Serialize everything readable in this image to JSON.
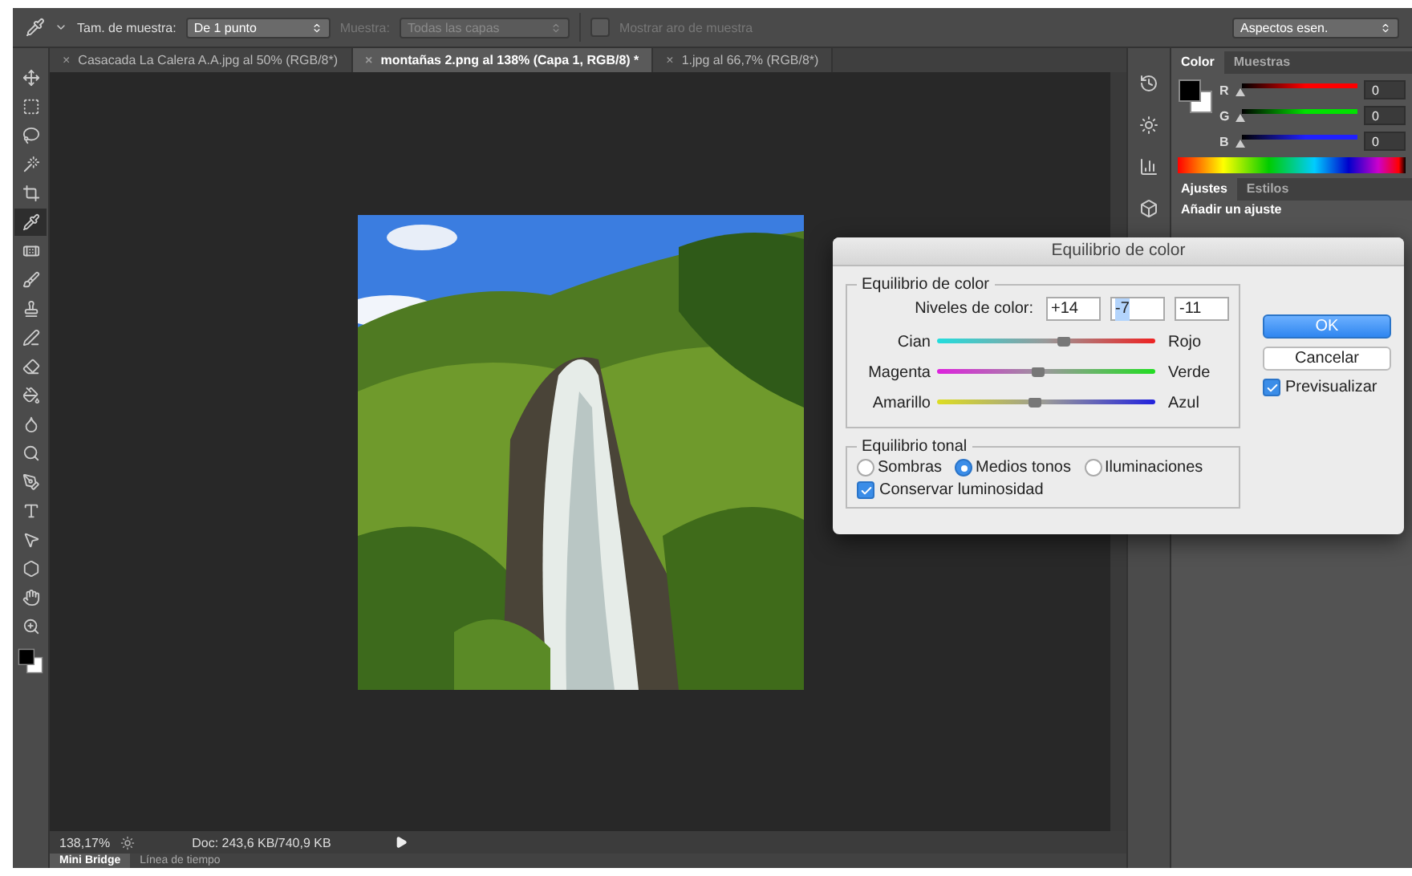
{
  "options_bar": {
    "sample_size_label": "Tam. de muestra:",
    "sample_size": "De 1 punto",
    "sample_label": "Muestra:",
    "sample": "Todas las capas",
    "show_ring": {
      "label": "Mostrar aro de muestra",
      "checked": false,
      "disabled": true
    },
    "workspace": "Aspectos esen."
  },
  "document_tabs": [
    {
      "close": "×",
      "label": "Casacada La Calera A.A.jpg al 50% (RGB/8*)",
      "selected": false
    },
    {
      "close": "×",
      "label": "montañas 2.png al 138% (Capa 1, RGB/8) *",
      "selected": true
    },
    {
      "close": "×",
      "label": "1.jpg al 66,7% (RGB/8*)",
      "selected": false
    }
  ],
  "tools": [
    {
      "kind": "move",
      "selected": false
    },
    {
      "kind": "marquee",
      "selected": false
    },
    {
      "kind": "lasso",
      "selected": false
    },
    {
      "kind": "wand",
      "selected": false
    },
    {
      "kind": "crop",
      "selected": false
    },
    {
      "kind": "eyedropper",
      "selected": true
    },
    {
      "kind": "healing",
      "selected": false
    },
    {
      "kind": "brush",
      "selected": false
    },
    {
      "kind": "stamp",
      "selected": false
    },
    {
      "kind": "history",
      "selected": false
    },
    {
      "kind": "eraser",
      "selected": false
    },
    {
      "kind": "bucket",
      "selected": false
    },
    {
      "kind": "blur",
      "selected": false
    },
    {
      "kind": "dodge",
      "selected": false
    },
    {
      "kind": "pen",
      "selected": false
    },
    {
      "kind": "type",
      "selected": false
    },
    {
      "kind": "select",
      "selected": false
    },
    {
      "kind": "shape",
      "selected": false
    },
    {
      "kind": "hand",
      "selected": false
    },
    {
      "kind": "zoom",
      "selected": false
    }
  ],
  "status_bar": {
    "zoom": "138,17%",
    "doc_info": "Doc: 243,6 KB/740,9 KB"
  },
  "bottom_tabs": [
    {
      "label": "Mini Bridge",
      "selected": true
    },
    {
      "label": "Línea de tiempo",
      "selected": false
    }
  ],
  "color_panel": {
    "tabs": [
      {
        "label": "Color",
        "selected": true
      },
      {
        "label": "Muestras",
        "selected": false
      }
    ],
    "channels": [
      {
        "label": "R",
        "value": "0",
        "level": 0,
        "color": "#ff0000"
      },
      {
        "label": "G",
        "value": "0",
        "level": 0,
        "color": "#00e000"
      },
      {
        "label": "B",
        "value": "0",
        "level": 0,
        "color": "#2020ff"
      }
    ]
  },
  "adjustments_panel": {
    "tabs": [
      {
        "label": "Ajustes",
        "selected": true
      },
      {
        "label": "Estilos",
        "selected": false
      }
    ],
    "heading": "Añadir un ajuste"
  },
  "dialog": {
    "title": "Equilibrio de color",
    "color_balance": {
      "legend": "Equilibrio de color",
      "levels_label": "Niveles de color:",
      "levels": [
        {
          "value": "+14",
          "selected": false
        },
        {
          "value": "-7",
          "selected": true
        },
        {
          "value": "-11",
          "selected": false
        }
      ],
      "sliders": [
        {
          "left": "Cian",
          "right": "Rojo",
          "level": 0.58
        },
        {
          "left": "Magenta",
          "right": "Verde",
          "level": 0.46
        },
        {
          "left": "Amarillo",
          "right": "Azul",
          "level": 0.45
        }
      ]
    },
    "tonal_balance": {
      "legend": "Equilibrio tonal",
      "options": [
        {
          "label": "Sombras",
          "selected": false
        },
        {
          "label": "Medios tonos",
          "selected": true
        },
        {
          "label": "Iluminaciones",
          "selected": false
        }
      ],
      "preserve_luminosity": {
        "label": "Conservar luminosidad",
        "checked": true
      }
    },
    "buttons": [
      {
        "label": "OK",
        "kind": "primary"
      },
      {
        "label": "Cancelar",
        "kind": "secondary"
      }
    ],
    "preview": {
      "label": "Previsualizar",
      "checked": true
    }
  }
}
